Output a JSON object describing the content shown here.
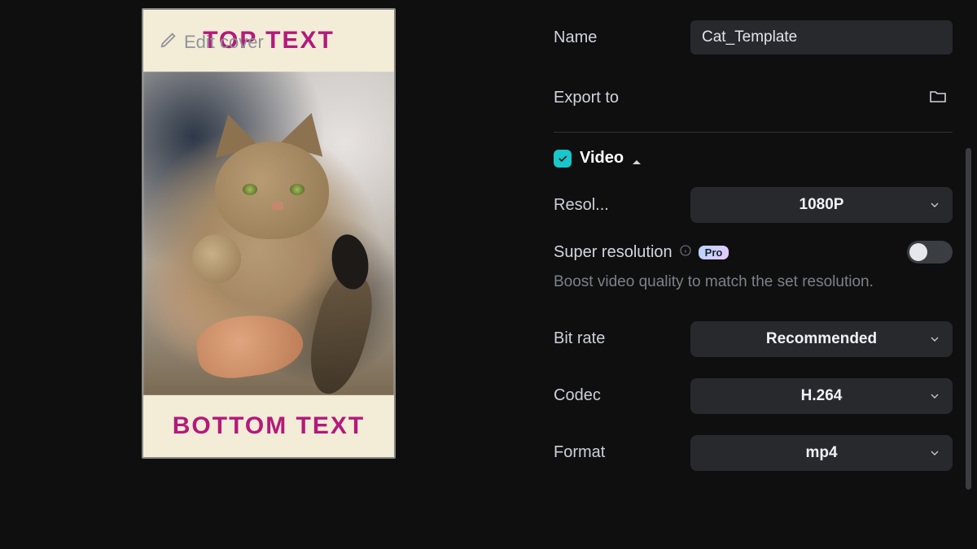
{
  "preview": {
    "top_text": "TOP TEXT",
    "bottom_text": "BOTTOM TEXT",
    "edit_cover_label": "Edit cover"
  },
  "panel": {
    "name_label": "Name",
    "name_value": "Cat_Template",
    "export_to_label": "Export to",
    "video_section_label": "Video",
    "resolution_label": "Resol...",
    "resolution_value": "1080P",
    "super_res_label": "Super resolution",
    "pro_badge": "Pro",
    "super_res_desc": "Boost video quality to match the set resolution.",
    "bitrate_label": "Bit rate",
    "bitrate_value": "Recommended",
    "codec_label": "Codec",
    "codec_value": "H.264",
    "format_label": "Format",
    "format_value": "mp4"
  }
}
